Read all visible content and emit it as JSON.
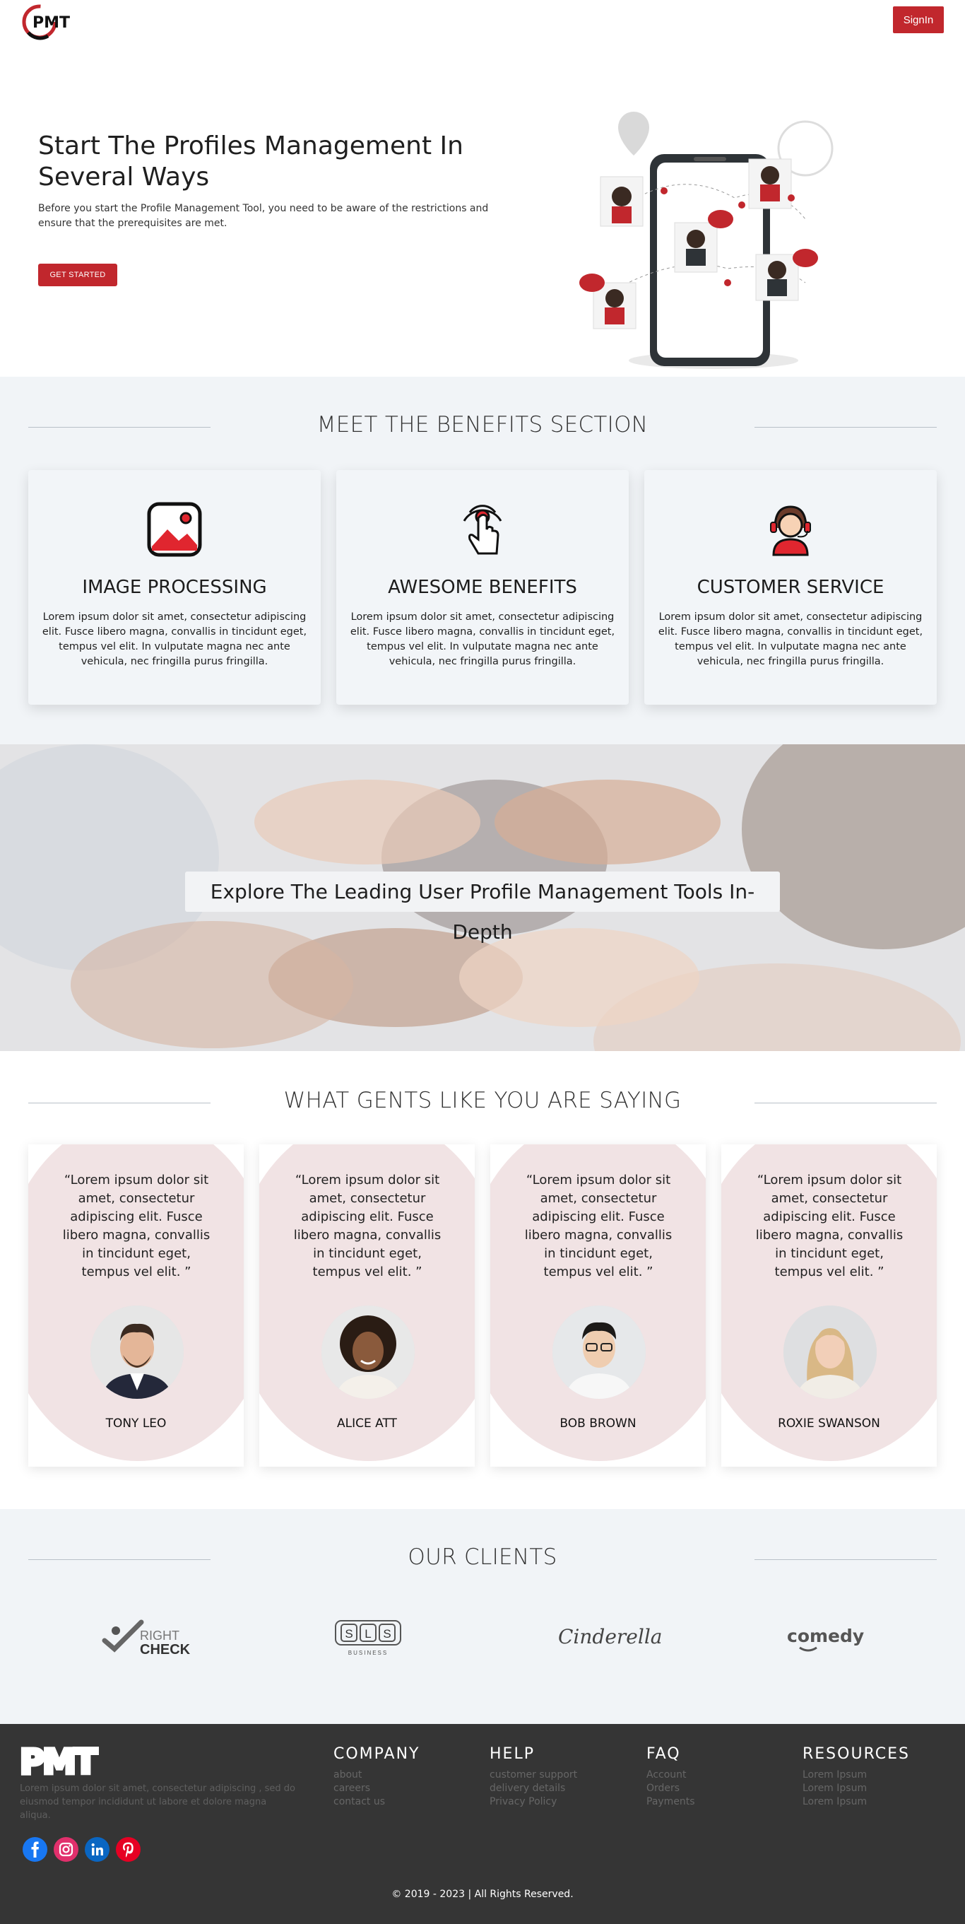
{
  "header": {
    "logo_text": "PMT",
    "signin_label": "SignIn"
  },
  "hero": {
    "title": "Start The Profiles Management In Several Ways",
    "text": "Before you start the Profile Management Tool, you need to be aware of the restrictions and ensure that the prerequisites are met.",
    "cta_label": "GET STARTED"
  },
  "benefits": {
    "title": "MEET THE BENEFITS SECTION",
    "cards": [
      {
        "icon": "image-icon",
        "title": "IMAGE PROCESSING",
        "text": "Lorem ipsum dolor sit amet, consectetur adipiscing elit. Fusce libero magna, convallis in tincidunt eget, tempus vel elit. In vulputate magna nec ante vehicula, nec fringilla purus fringilla."
      },
      {
        "icon": "touch-icon",
        "title": "AWESOME BENEFITS",
        "text": "Lorem ipsum dolor sit amet, consectetur adipiscing elit. Fusce libero magna, convallis in tincidunt eget, tempus vel elit. In vulputate magna nec ante vehicula, nec fringilla purus fringilla."
      },
      {
        "icon": "headset-agent-icon",
        "title": "CUSTOMER SERVICE",
        "text": "Lorem ipsum dolor sit amet, consectetur adipiscing elit. Fusce libero magna, convallis in tincidunt eget, tempus vel elit. In vulputate magna nec ante vehicula, nec fringilla purus fringilla."
      }
    ]
  },
  "banner": {
    "text": "Explore The Leading User Profile Management Tools In-Depth"
  },
  "testimonials": {
    "title": "WHAT GENTS LIKE YOU ARE SAYING",
    "items": [
      {
        "quote": "“Lorem ipsum dolor sit amet, consectetur adipiscing elit. Fusce libero magna, convallis in tincidunt eget, tempus vel elit. ”",
        "name": "TONY LEO"
      },
      {
        "quote": "“Lorem ipsum dolor sit amet, consectetur adipiscing elit. Fusce libero magna, convallis in tincidunt eget, tempus vel elit. ”",
        "name": "ALICE ATT"
      },
      {
        "quote": "“Lorem ipsum dolor sit amet, consectetur adipiscing elit. Fusce libero magna, convallis in tincidunt eget, tempus vel elit. ”",
        "name": "BOB BROWN"
      },
      {
        "quote": "“Lorem ipsum dolor sit amet, consectetur adipiscing elit. Fusce libero magna, convallis in tincidunt eget, tempus vel elit. ”",
        "name": "ROXIE SWANSON"
      }
    ]
  },
  "clients": {
    "title": "OUR CLIENTS",
    "logos": [
      {
        "line1": "RIGHT",
        "line2": "CHECK"
      },
      {
        "letters": [
          "S",
          "L",
          "S"
        ],
        "sub": "BUSINESS"
      },
      {
        "text": "Cinderella"
      },
      {
        "text": "comedy"
      }
    ]
  },
  "footer": {
    "logo_text": "PMT",
    "description": "Lorem ipsum dolor sit amet, consectetur adipiscing , sed do eiusmod tempor incididunt ut labore et dolore magna aliqua.",
    "social": [
      "facebook-icon",
      "instagram-icon",
      "linkedin-icon",
      "pinterest-icon"
    ],
    "columns": [
      {
        "title": "COMPANY",
        "links": [
          "about",
          "careers",
          "contact us"
        ]
      },
      {
        "title": "HELP",
        "links": [
          "customer support",
          "delivery details",
          "Privacy Policy"
        ]
      },
      {
        "title": "FAQ",
        "links": [
          "Account",
          "Orders",
          "Payments"
        ]
      },
      {
        "title": "RESOURCES",
        "links": [
          "Lorem Ipsum",
          "Lorem Ipsum",
          "Lorem Ipsum"
        ]
      }
    ],
    "copyright": "© 2019 - 2023 | All Rights Reserved."
  },
  "colors": {
    "accent": "#c1272d",
    "section_bg": "#f1f4f7",
    "footer_bg": "#353535",
    "testimonial_blob": "#f1e3e4"
  }
}
